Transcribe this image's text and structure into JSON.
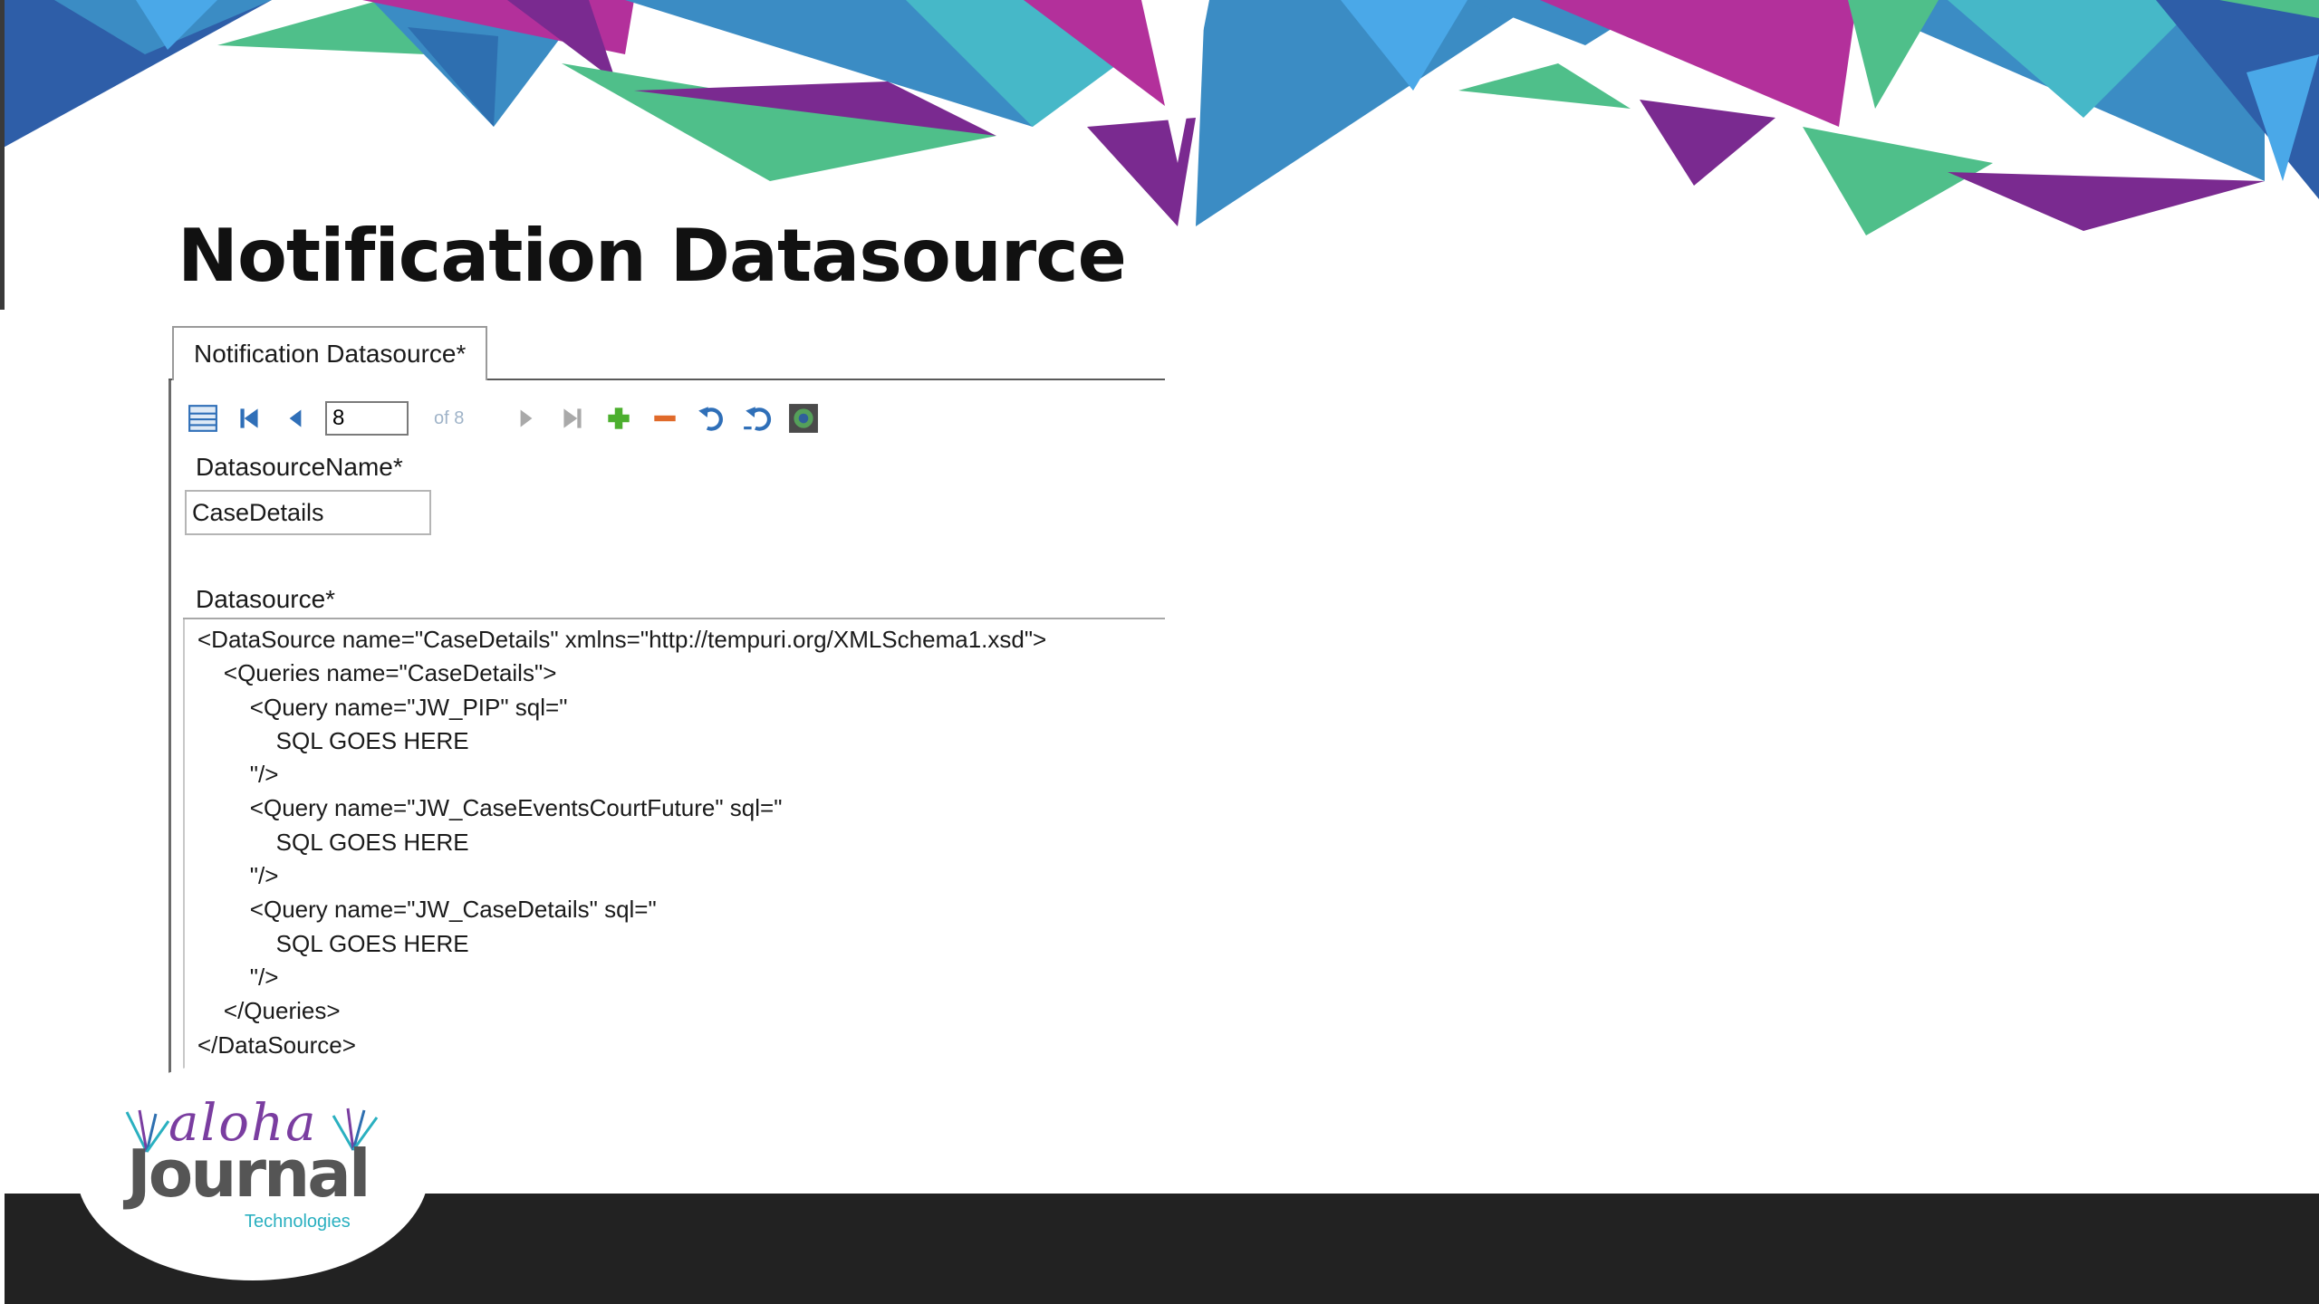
{
  "slide": {
    "title": "Notification Datasource"
  },
  "panel": {
    "tab_label": "Notification Datasource*",
    "toolbar": {
      "icons": [
        "list-view-icon",
        "first-record-icon",
        "previous-record-icon",
        "next-record-icon",
        "last-record-icon",
        "add-record-icon",
        "remove-record-icon",
        "undo-icon",
        "undo-all-icon",
        "refresh-icon"
      ],
      "record_value": "8",
      "of_label": "of 8"
    },
    "datasource_name": {
      "label": "DatasourceName*",
      "value": "CaseDetails"
    },
    "datasource": {
      "label": "Datasource*",
      "text": "<DataSource name=\"CaseDetails\" xmlns=\"http://tempuri.org/XMLSchema1.xsd\">\n    <Queries name=\"CaseDetails\">\n        <Query name=\"JW_PIP\" sql=\"\n            SQL GOES HERE\n        \"/>\n        <Query name=\"JW_CaseEventsCourtFuture\" sql=\"\n            SQL GOES HERE\n        \"/>\n        <Query name=\"JW_CaseDetails\" sql=\"\n            SQL GOES HERE\n        \"/>\n    </Queries>\n</DataSource>"
    }
  },
  "logo": {
    "script": "aloha",
    "word": "Journal",
    "sub": "Technologies"
  },
  "colors": {
    "accent_blue": "#3b8cc4",
    "accent_purple": "#7a2a90",
    "accent_magenta": "#b3309b",
    "accent_green": "#4fbf8a",
    "accent_teal": "#46b8c8",
    "footer": "#222222"
  }
}
